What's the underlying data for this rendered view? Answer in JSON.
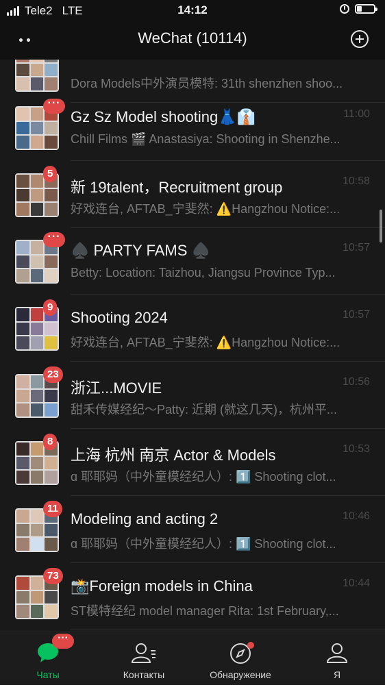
{
  "status": {
    "carrier": "Tele2",
    "network": "LTE",
    "time": "14:12"
  },
  "header": {
    "title": "WeChat (10114)"
  },
  "chats": [
    {
      "name": "",
      "time": "",
      "preview": "Dora Models中外演员模特: 31th shenzhen shoo...",
      "badge": "",
      "colors": [
        "#b07a6a",
        "#e8c6b0",
        "#7a7a7a",
        "#5b4a3e",
        "#c9a88e",
        "#8fb0c8",
        "#d8c0b0",
        "#5a5a6a",
        "#a08070"
      ]
    },
    {
      "name": "Gz Sz Model  shooting👗👔",
      "time": "11:00",
      "preview": "Chill Films 🎬 Anastasiya: Shooting in Shenzhe...",
      "badge": "···",
      "colors": [
        "#e0c4b0",
        "#c8a088",
        "#b04a3a",
        "#3a6a9a",
        "#7a8aa0",
        "#c0b0a0",
        "#4a6a8a",
        "#d0a890",
        "#6a4a3a"
      ]
    },
    {
      "name": "新 19talent，Recruitment group",
      "time": "10:58",
      "preview": "好戏连台, AFTAB_宁斐然: ⚠️Hangzhou Notice:...",
      "badge": "5",
      "colors": [
        "#6a5040",
        "#b08870",
        "#8a6a5a",
        "#4a3a30",
        "#c09a80",
        "#7a5a4a",
        "#a07a60",
        "#3a3a3a",
        "#9a8070"
      ]
    },
    {
      "name": "♠️ PARTY FAMS ♠️",
      "time": "10:57",
      "preview": "Betty: Location: Taizhou, Jiangsu Province Typ...",
      "badge": "···",
      "colors": [
        "#a0b0c8",
        "#c8b0a0",
        "#6a7a8a",
        "#4a4a5a",
        "#d0c0b0",
        "#8a6a5a",
        "#b0a090",
        "#5a6a7a",
        "#e0d0c0"
      ]
    },
    {
      "name": "Shooting 2024",
      "time": "10:57",
      "preview": "好戏连台, AFTAB_宁斐然: ⚠️Hangzhou Notice:...",
      "badge": "9",
      "colors": [
        "#2a2a3a",
        "#c04040",
        "#6a5aa0",
        "#3a3a4a",
        "#8a7a9a",
        "#d0c0d0",
        "#4a4a5a",
        "#a0a0b0",
        "#e0c040"
      ]
    },
    {
      "name": "浙江...MOVIE",
      "time": "10:56",
      "preview": "甜禾传媒经纪～Patty: 近期 (就这几天)，杭州平...",
      "badge": "23",
      "colors": [
        "#d0b0a0",
        "#8a9aa0",
        "#5a4a4a",
        "#c8a890",
        "#6a6a7a",
        "#3a3a4a",
        "#b09080",
        "#4a5a6a",
        "#7aa0d0"
      ]
    },
    {
      "name": "上海 杭州 南京 Actor & Models",
      "time": "10:53",
      "preview": "ɑ 耶耶妈（中外童模经纪人）: 1️⃣ Shooting clot...",
      "badge": "8",
      "colors": [
        "#3a2a2a",
        "#c89a70",
        "#7a6a5a",
        "#5a5a6a",
        "#a08a7a",
        "#d0b090",
        "#4a3a3a",
        "#8a7a6a",
        "#b0a0a0"
      ]
    },
    {
      "name": "Modeling and acting 2",
      "time": "10:46",
      "preview": "ɑ 耶耶妈（中外童模经纪人）: 1️⃣ Shooting clot...",
      "badge": "11",
      "colors": [
        "#c8a890",
        "#e0c8b8",
        "#5a6a7a",
        "#8a7a6a",
        "#b09a88",
        "#4a5a6a",
        "#a08070",
        "#d0e0f0",
        "#6a5a4a"
      ]
    },
    {
      "name": "📸Foreign models in China",
      "time": "10:44",
      "preview": "ST模特经纪 model manager Rita: 1st February,...",
      "badge": "73",
      "colors": [
        "#b04a3a",
        "#d0b098",
        "#6a5a4a",
        "#8a7a6a",
        "#c09878",
        "#4a4a4a",
        "#a0887a",
        "#5a6a5a",
        "#e0c8a8"
      ]
    }
  ],
  "tabbar": {
    "chats": "Чаты",
    "chats_badge": "···",
    "contacts": "Контакты",
    "discover": "Обнаружение",
    "me": "Я",
    "active_color": "#07c160"
  }
}
